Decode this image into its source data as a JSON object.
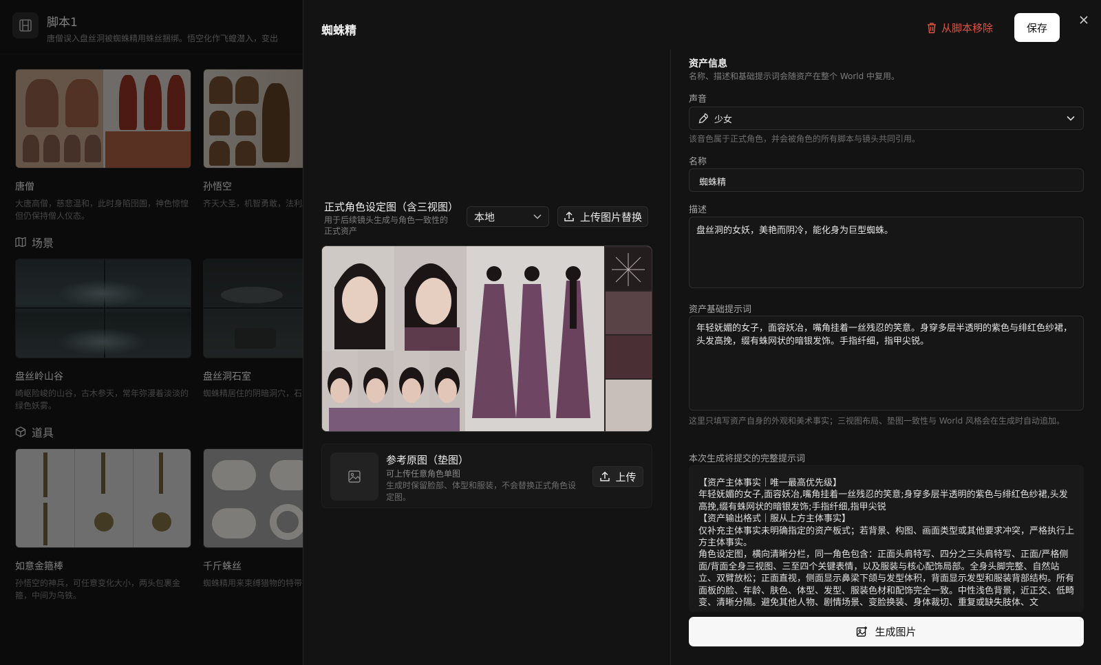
{
  "background": {
    "app_title": "脚本1",
    "app_subtitle": "唐僧误入盘丝洞被蜘蛛精用蛛丝捆绑。悟空化作飞蝗潜入，变出",
    "characters": [
      {
        "name": "唐僧",
        "desc": "大唐高僧，慈悲温和，此时身陷囹圄，神色惊惶但仍保持僧人仪态。"
      },
      {
        "name": "孙悟空",
        "desc": "齐天大圣，机智勇敢，法利。"
      }
    ],
    "scenes_title": "场景",
    "scenes": [
      {
        "name": "盘丝岭山谷",
        "desc": "崎岖险峻的山谷，古木参天，常年弥漫着淡淡的绿色妖雾。"
      },
      {
        "name": "盘丝洞石室",
        "desc": "蜘蛛精居住的阴暗洞穴，石台与巨大的蒸笼。"
      }
    ],
    "props_title": "道具",
    "props": [
      {
        "name": "如意金箍棒",
        "desc": "孙悟空的神兵，可任意变化大小，两头包裹金箍，中间为乌铁。"
      },
      {
        "name": "千斤蛛丝",
        "desc": "蜘蛛精用来束缚猎物的特带有粘性。"
      }
    ]
  },
  "modal": {
    "title": "蜘蛛精",
    "remove_label": "从脚本移除",
    "save_label": "保存",
    "sheet": {
      "title": "正式角色设定图（含三视图）",
      "subtitle": "用于后续镜头生成与角色一致性的正式资产",
      "source_value": "本地",
      "upload_replace_label": "上传图片替换"
    },
    "reference": {
      "title": "参考原图（垫图）",
      "sub1": "可上传任意角色单图",
      "sub2": "生成时保留脸部、体型和服装，不会替换正式角色设定图。",
      "upload_label": "上传"
    },
    "info": {
      "title": "资产信息",
      "subtitle": "名称、描述和基础提示词会随资产在整个 World 中复用。",
      "voice_label": "声音",
      "voice_value": "少女",
      "voice_hint": "该音色属于正式角色，并会被角色的所有脚本与镜头共同引用。",
      "name_label": "名称",
      "name_value": "蜘蛛精",
      "desc_label": "描述",
      "desc_value": "盘丝洞的女妖，美艳而阴冷，能化身为巨型蜘蛛。",
      "prompt_label": "资产基础提示词",
      "prompt_value": "年轻妩媚的女子，面容妖冶，嘴角挂着一丝残忍的笑意。身穿多层半透明的紫色与绯红色纱裙，头发高挽，缀有蛛网状的暗银发饰。手指纤细，指甲尖锐。",
      "prompt_hint": "这里只填写资产自身的外观和美术事实；三视图布局、垫图一致性与 World 风格会在生成时自动追加。",
      "full_prompt_label": "本次生成将提交的完整提示词",
      "full_prompt_lines": [
        "【资产主体事实｜唯一最高优先级】",
        "年轻妩媚的女子,面容妖冶,嘴角挂着一丝残忍的笑意;身穿多层半透明的紫色与绯红色纱裙,头发高挽,缀有蛛网状的暗银发饰;手指纤细,指甲尖锐",
        "【资产输出格式｜服从上方主体事实】",
        "仅补充主体事实未明确指定的资产板式；若背景、构图、画面类型或其他要求冲突，严格执行上方主体事实。",
        "角色设定图，横向清晰分栏，同一角色包含：正面头肩特写、四分之三头肩特写、正面/严格侧面/背面全身三视图、三至四个关键表情，以及服装与核心配饰局部。全身头脚完整、自然站立、双臂放松；正面直视，侧面显示鼻梁下颌与发型体积，背面显示发型和服装背部结构。所有面板的脸、年龄、肤色、体型、发型、服装色材和配饰完全一致。中性浅色背景，近正交、低畸变、清晰分隔。避免其他人物、剧情场景、变脸换装、身体裁切、重复或缺失肢体、文"
      ],
      "generate_label": "生成图片"
    }
  }
}
